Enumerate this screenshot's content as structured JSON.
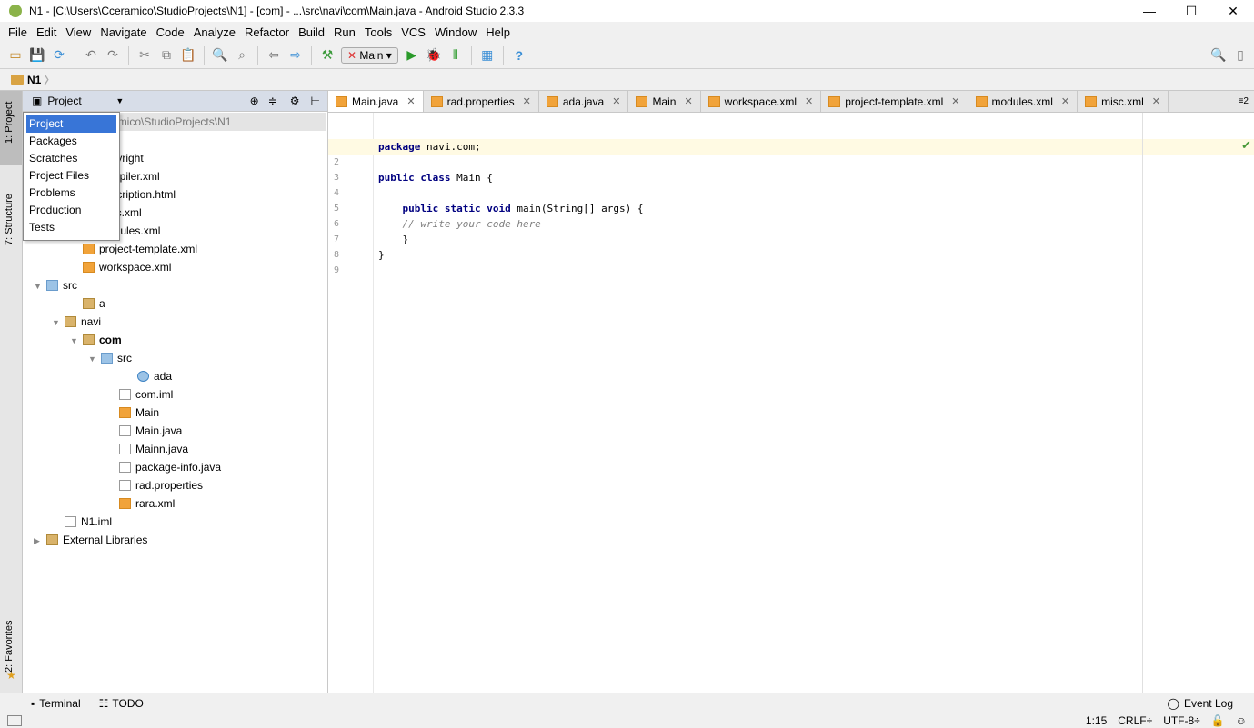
{
  "window": {
    "title": "N1 - [C:\\Users\\Cceramico\\StudioProjects\\N1] - [com] - ...\\src\\navi\\com\\Main.java - Android Studio 2.3.3",
    "minimize": "—",
    "maximize": "☐",
    "close": "✕"
  },
  "menu": [
    "File",
    "Edit",
    "View",
    "Navigate",
    "Code",
    "Analyze",
    "Refactor",
    "Build",
    "Run",
    "Tools",
    "VCS",
    "Window",
    "Help"
  ],
  "toolbar": {
    "run_config": "Main"
  },
  "navbar": {
    "crumb": "N1"
  },
  "side_tabs": {
    "project": "1: Project",
    "structure": "7: Structure",
    "favorites": "2: Favorites"
  },
  "project_panel": {
    "view_selector": "Project",
    "root_path": "N1  C:\\Users\\Cceramico\\StudioProjects\\N1"
  },
  "view_popup": [
    "Project",
    "Packages",
    "Scratches",
    "Project Files",
    "Problems",
    "Production",
    "Tests"
  ],
  "tree": [
    {
      "label": "copyright",
      "depth": 3,
      "icon": "folder"
    },
    {
      "label": "compiler.xml",
      "depth": 3,
      "icon": "xml"
    },
    {
      "label": "description.html",
      "depth": 3,
      "icon": "file"
    },
    {
      "label": "misc.xml",
      "depth": 3,
      "icon": "xml"
    },
    {
      "label": "modules.xml",
      "depth": 3,
      "icon": "xml"
    },
    {
      "label": "project-template.xml",
      "depth": 3,
      "icon": "xml"
    },
    {
      "label": "workspace.xml",
      "depth": 3,
      "icon": "xml"
    },
    {
      "label": "src",
      "depth": 1,
      "icon": "src",
      "expanded": true
    },
    {
      "label": "a",
      "depth": 3,
      "icon": "folder"
    },
    {
      "label": "navi",
      "depth": 2,
      "icon": "folder",
      "expanded": true
    },
    {
      "label": "com",
      "depth": 3,
      "icon": "folder",
      "expanded": true,
      "bold": true
    },
    {
      "label": "src",
      "depth": 4,
      "icon": "src",
      "expanded": true
    },
    {
      "label": "ada",
      "depth": 6,
      "icon": "class"
    },
    {
      "label": "com.iml",
      "depth": 5,
      "icon": "file"
    },
    {
      "label": "Main",
      "depth": 5,
      "icon": "xml"
    },
    {
      "label": "Main.java",
      "depth": 5,
      "icon": "file"
    },
    {
      "label": "Mainn.java",
      "depth": 5,
      "icon": "file"
    },
    {
      "label": "package-info.java",
      "depth": 5,
      "icon": "file"
    },
    {
      "label": "rad.properties",
      "depth": 5,
      "icon": "file"
    },
    {
      "label": "rara.xml",
      "depth": 5,
      "icon": "xml"
    },
    {
      "label": "N1.iml",
      "depth": 2,
      "icon": "file"
    },
    {
      "label": "External Libraries",
      "depth": 1,
      "icon": "lib",
      "collapsed": true
    }
  ],
  "tabs": [
    {
      "label": "Main.java",
      "active": true
    },
    {
      "label": "rad.properties"
    },
    {
      "label": "ada.java"
    },
    {
      "label": "Main"
    },
    {
      "label": "workspace.xml"
    },
    {
      "label": "project-template.xml"
    },
    {
      "label": "modules.xml"
    },
    {
      "label": "misc.xml"
    }
  ],
  "tabs_overflow": "≡2",
  "code": [
    "package navi.com;",
    "",
    "public class Main {",
    "",
    "    public static void main(String[] args) {",
    "    // write your code here",
    "    }",
    "}",
    ""
  ],
  "bottom_tools": {
    "terminal": "Terminal",
    "todo": "TODO",
    "event_log": "Event Log"
  },
  "status": {
    "position": "1:15",
    "line_sep": "CRLF÷",
    "encoding": "UTF-8÷"
  },
  "colors": {
    "selection": "#3875d7",
    "current_line": "#fffae3",
    "keyword": "#000080"
  }
}
